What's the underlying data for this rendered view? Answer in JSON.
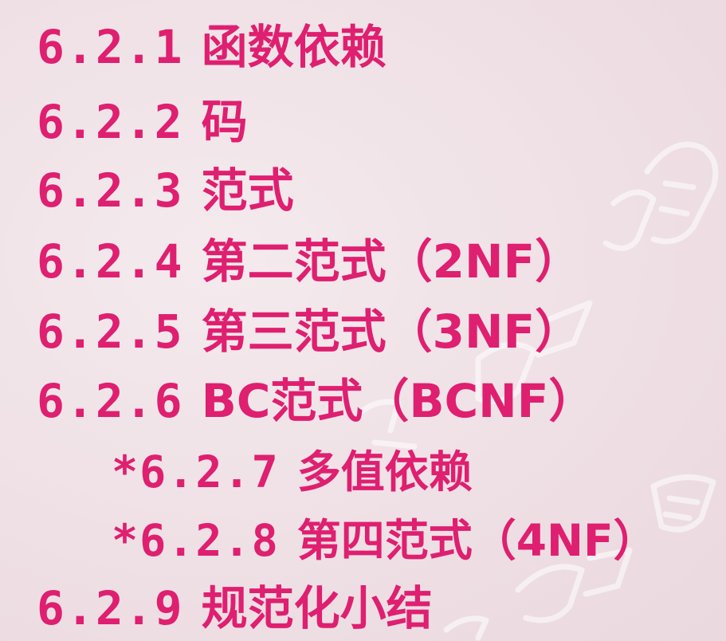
{
  "toc": {
    "items": [
      {
        "number": "6.2.1",
        "title": "函数依赖"
      },
      {
        "number": "6.2.2",
        "title": "码"
      },
      {
        "number": "6.2.3",
        "title": "范式"
      },
      {
        "number": "6.2.4",
        "title": "第二范式（2NF）"
      },
      {
        "number": "6.2.5",
        "title": "第三范式（3NF）"
      },
      {
        "number": "6.2.6",
        "title": "BC范式（BCNF）"
      },
      {
        "number": "*6.2.7",
        "title": "多值依赖"
      },
      {
        "number": "*6.2.8",
        "title": "第四范式（4NF）"
      },
      {
        "number": "6.2.9",
        "title": "规范化小结"
      }
    ]
  },
  "colors": {
    "text": "#df1f70",
    "background": "#f0e3e7",
    "watermark": "#ffffff"
  }
}
